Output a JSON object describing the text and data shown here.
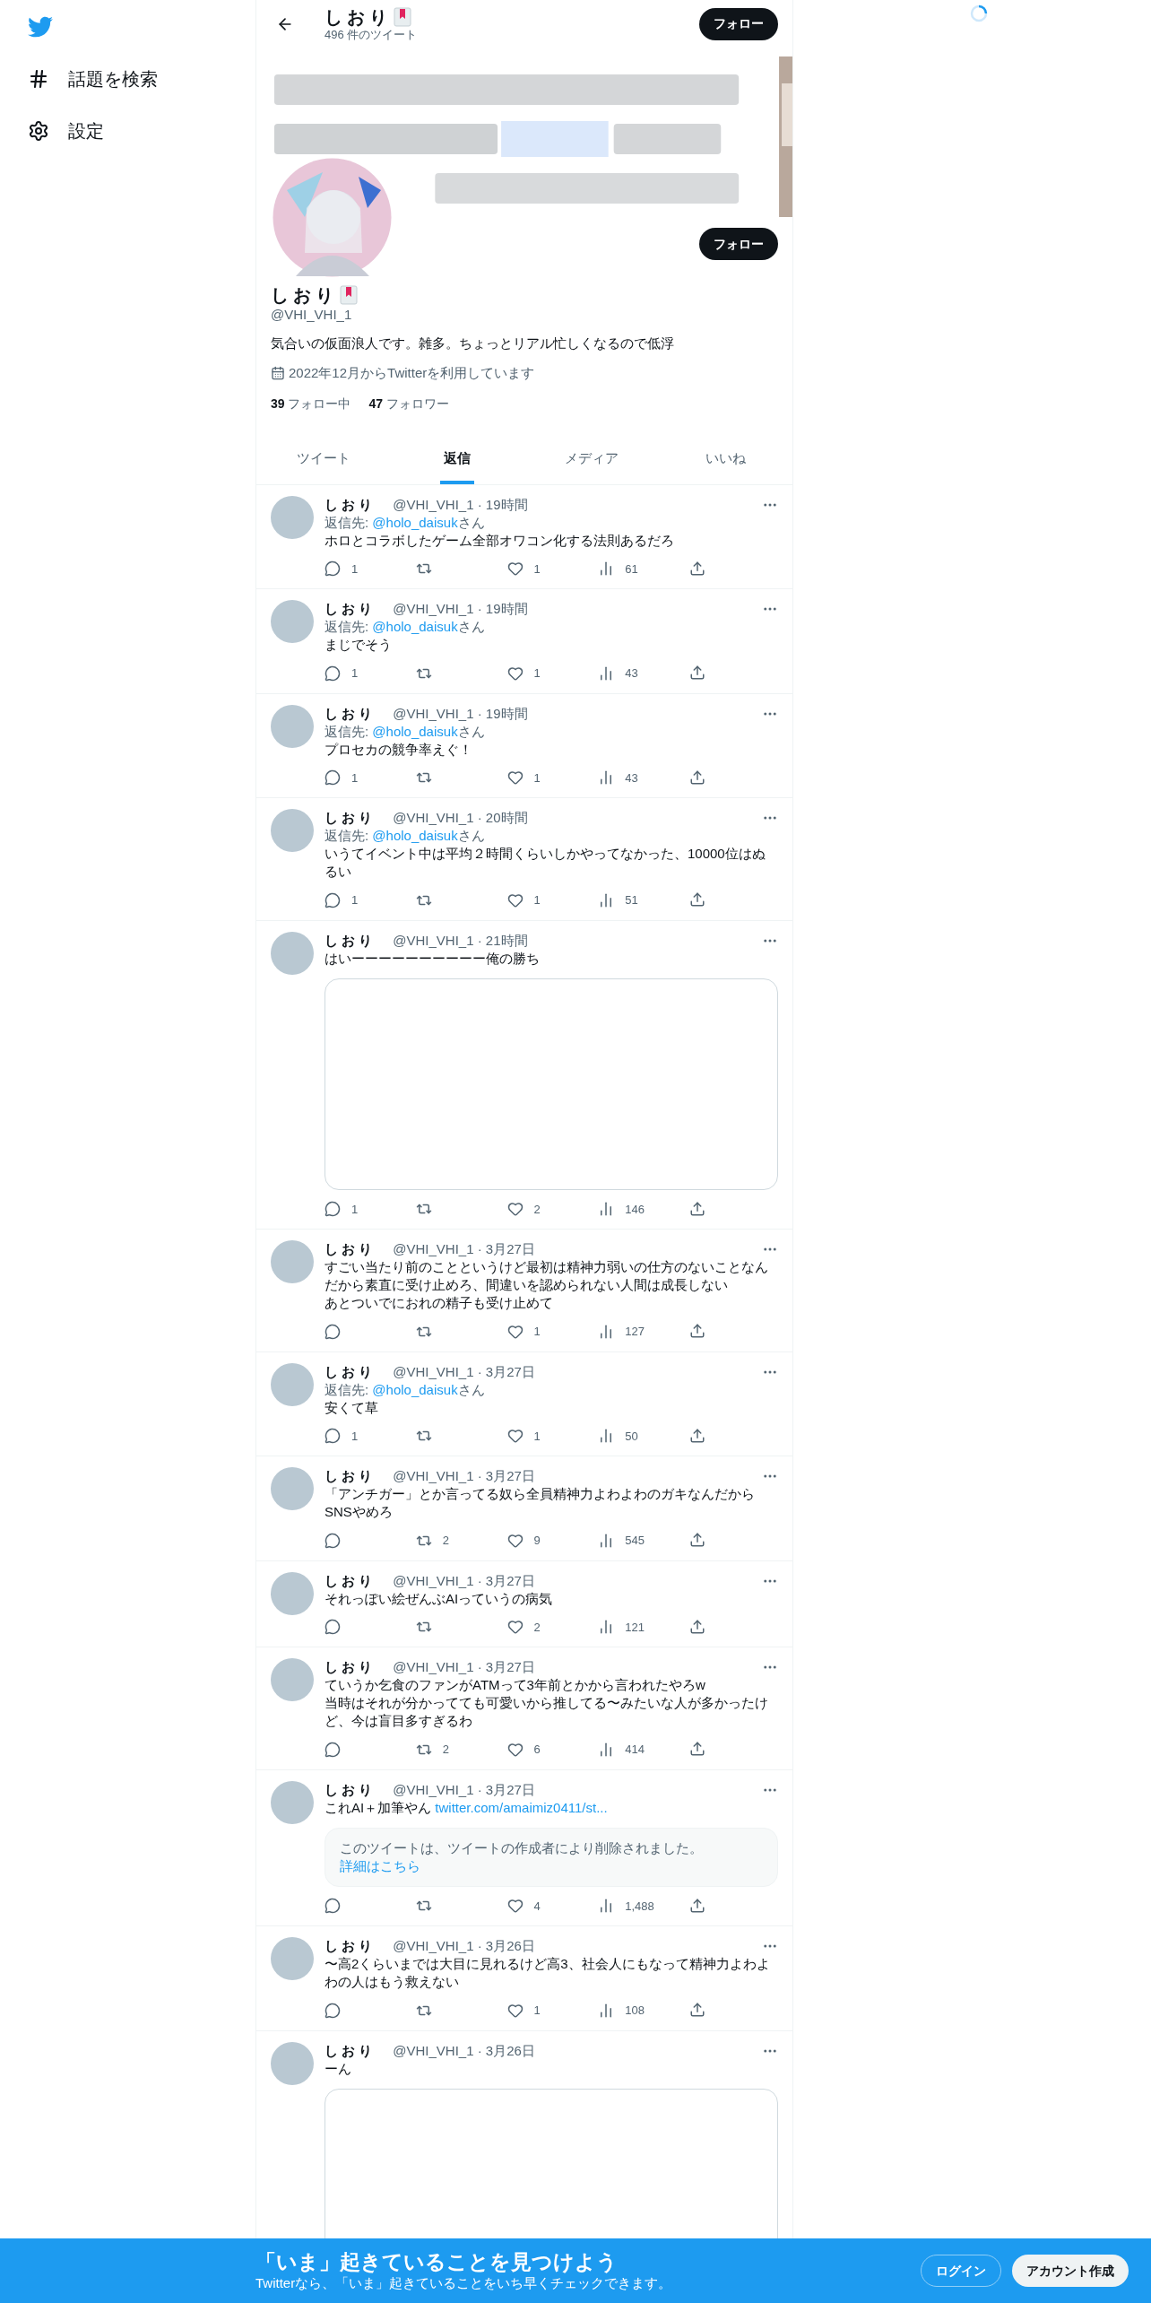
{
  "sidebar": {
    "items": [
      {
        "kind": "search",
        "label": "話題を検索"
      },
      {
        "kind": "settings",
        "label": "設定"
      }
    ]
  },
  "header": {
    "name": "しおり",
    "tweet_count": "496 件のツイート",
    "follow_button": "フォロー"
  },
  "profile": {
    "name": "しおり",
    "handle": "@VHI_VHI_1",
    "follow_button": "フォロー",
    "bio": "気合いの仮面浪人です。雑多。ちょっとリアル忙しくなるので低浮",
    "joined": "2022年12月からTwitterを利用しています",
    "following": "**39** フォロー中",
    "followers": "**47** フォロワー"
  },
  "tabs": [
    {
      "label": "ツイート",
      "selected": false
    },
    {
      "label": "返信",
      "selected": true
    },
    {
      "label": "メディア",
      "selected": false
    },
    {
      "label": "いいね",
      "selected": false
    }
  ],
  "tweets": [
    {
      "name": "しおり",
      "meta": "@VHI_VHI_1 · 19時間",
      "reply_prefix": "返信先: ",
      "reply_user": "@holo_daisuk",
      "reply_suffix": "さん",
      "text": "ホロとコラボしたゲーム全部オワコン化する法則あるだろ",
      "replies": "1",
      "likes": "1",
      "views": "61"
    },
    {
      "name": "しおり",
      "meta": "@VHI_VHI_1 · 19時間",
      "reply_prefix": "返信先: ",
      "reply_user": "@holo_daisuk",
      "reply_suffix": "さん",
      "text": "まじでそう",
      "replies": "1",
      "likes": "1",
      "views": "43"
    },
    {
      "name": "しおり",
      "meta": "@VHI_VHI_1 · 19時間",
      "reply_prefix": "返信先: ",
      "reply_user": "@holo_daisuk",
      "reply_suffix": "さん",
      "text": "プロセカの競争率えぐ！",
      "replies": "1",
      "likes": "1",
      "views": "43"
    },
    {
      "name": "しおり",
      "meta": "@VHI_VHI_1 · 20時間",
      "reply_prefix": "返信先: ",
      "reply_user": "@holo_daisuk",
      "reply_suffix": "さん",
      "text": "いうてイベント中は平均２時間くらいしかやってなかった、10000位はぬるい",
      "replies": "1",
      "likes": "1",
      "views": "51"
    },
    {
      "name": "しおり",
      "meta": "@VHI_VHI_1 · 21時間",
      "text": "はいーーーーーーーーーー俺の勝ち",
      "attachment": {
        "kind": "media"
      },
      "replies": "1",
      "likes": "2",
      "views": "146"
    },
    {
      "name": "しおり",
      "meta": "@VHI_VHI_1 · 3月27日",
      "text": "すごい当たり前のことというけど最初は精神力弱いの仕方のないことなんだから素直に受け止めろ、間違いを認められない人間は成長しない",
      "text_2": "あとついでにおれの精子も受け止めて",
      "likes": "1",
      "views": "127"
    },
    {
      "name": "しおり",
      "meta": "@VHI_VHI_1 · 3月27日",
      "reply_prefix": "返信先: ",
      "reply_user": "@holo_daisuk",
      "reply_suffix": "さん",
      "text": "安くて草",
      "replies": "1",
      "likes": "1",
      "views": "50"
    },
    {
      "name": "しおり",
      "meta": "@VHI_VHI_1 · 3月27日",
      "text": "「アンチガー」とか言ってる奴ら全員精神力よわよわのガキなんだからSNSやめろ",
      "retweets": "2",
      "likes": "9",
      "views": "545"
    },
    {
      "name": "しおり",
      "meta": "@VHI_VHI_1 · 3月27日",
      "text": "それっぽい絵ぜんぶAIっていうの病気",
      "likes": "2",
      "views": "121"
    },
    {
      "name": "しおり",
      "meta": "@VHI_VHI_1 · 3月27日",
      "text": "ていうか乞食のファンがATMって3年前とかから言われたやろw",
      "text_2": "当時はそれが分かってても可愛いから推してる〜みたいな人が多かったけど、今は盲目多すぎるわ",
      "retweets": "2",
      "likes": "6",
      "views": "414"
    },
    {
      "name": "しおり",
      "meta": "@VHI_VHI_1 · 3月27日",
      "text": "これAI＋加筆やん",
      "link": "twitter.com/amaimiz0411/st...",
      "attachment": {
        "kind": "deleted",
        "text": "このツイートは、ツイートの作成者により削除されました。",
        "link": "詳細はこちら"
      },
      "likes": "4",
      "views": "1,488"
    },
    {
      "name": "しおり",
      "meta": "@VHI_VHI_1 · 3月26日",
      "text": "〜高2くらいまでは大目に見れるけど高3、社会人にもなって精神力よわよわの人はもう救えない",
      "likes": "1",
      "views": "108"
    },
    {
      "name": "しおり",
      "meta": "@VHI_VHI_1 · 3月26日",
      "text": "ーん",
      "attachment": {
        "kind": "media"
      }
    }
  ],
  "signup_bar": {
    "title": "「いま」起きていることを見つけよう",
    "subtitle": "Twitterなら、「いま」起きていることをいち早くチェックできます。",
    "login_button": "ログイン",
    "signup_button": "アカウント作成"
  }
}
